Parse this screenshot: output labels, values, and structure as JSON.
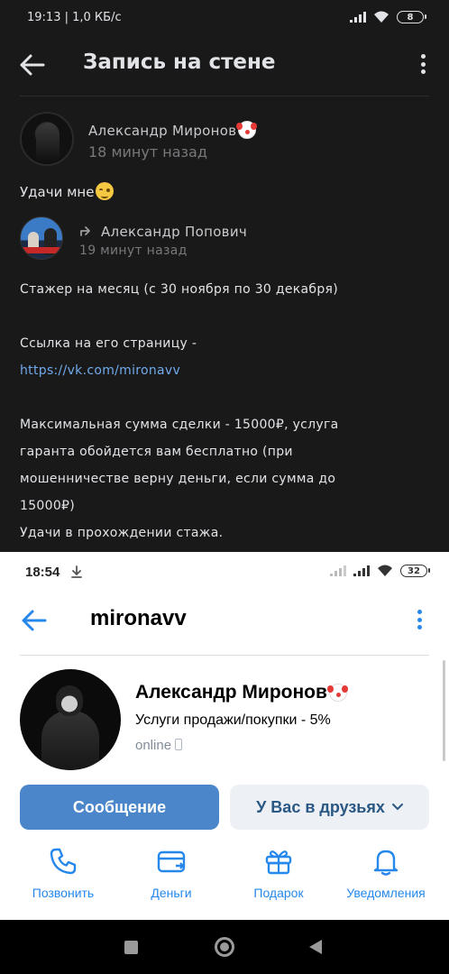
{
  "dark_screen": {
    "status_bar": {
      "time_speed": "19:13 | 1,0 КБ/с",
      "battery": "8"
    },
    "header": {
      "title": "Запись на стене"
    },
    "post": {
      "author_name": "Александр Миронов",
      "time": "18 минут назад",
      "text": "Удачи мне"
    },
    "repost": {
      "author_name": "Александр Попович",
      "time": "19 минут назад",
      "lines": {
        "l1": "Стажер на месяц (с 30 ноября по 30 декабря)",
        "l2": "Ссылка на его страницу -",
        "link": "https://vk.com/mironavv",
        "l3": "Максимальная сумма сделки - 15000₽, услуга",
        "l4": "гаранта обойдется вам бесплатно (при",
        "l5": "мошенничестве верну деньги, если сумма до",
        "l6": "15000₽)",
        "l7": "Удачи в прохождении стажа."
      }
    }
  },
  "light_screen": {
    "status_bar": {
      "time": "18:54",
      "battery": "32"
    },
    "header": {
      "title": "mironavv"
    },
    "profile": {
      "name": "Александр Миронов",
      "status": "Услуги продажи/покупки - 5%",
      "online": "online"
    },
    "buttons": {
      "message": "Сообщение",
      "friends": "У Вас в друзьях"
    },
    "actions": {
      "call": "Позвонить",
      "money": "Деньги",
      "gift": "Подарок",
      "notifications": "Уведомления"
    }
  },
  "colors": {
    "dark_bg": "#19191a",
    "vk_blue": "#2688eb",
    "primary_button": "#4a86c9",
    "link_dark": "#71aaeb"
  },
  "icons": [
    "back-arrow-icon",
    "more-vertical-icon",
    "clown-face-icon",
    "face-emoji-icon",
    "share-icon",
    "download-icon",
    "phone-icon",
    "wallet-icon",
    "gift-icon",
    "bell-icon",
    "chevron-down-icon"
  ]
}
